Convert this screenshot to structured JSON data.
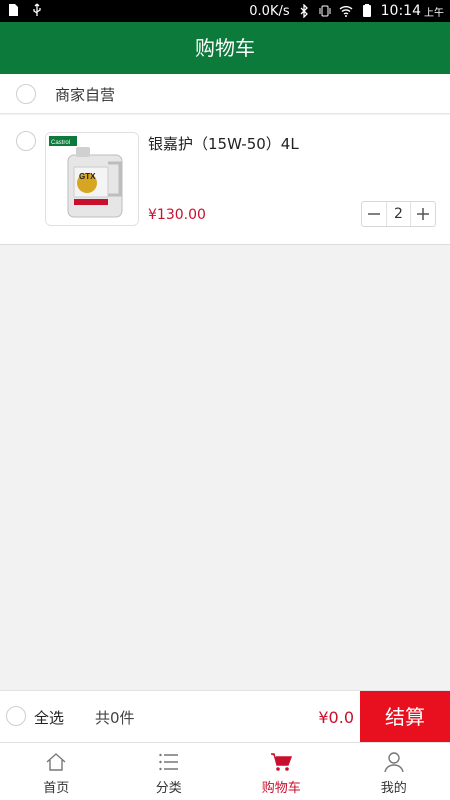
{
  "status_bar": {
    "speed": "0.0K/s",
    "time": "10:14",
    "ampm": "上午"
  },
  "header": {
    "title": "购物车"
  },
  "store": {
    "name": "商家自营"
  },
  "product": {
    "name": "银嘉护（15W-50）4L",
    "price": "¥130.00",
    "quantity": "2",
    "image_brand": "Castrol",
    "image_model": "GTX"
  },
  "checkout": {
    "select_all": "全选",
    "count": "共0件",
    "total": "¥0.0",
    "settle": "结算"
  },
  "tabs": [
    {
      "label": "首页",
      "icon": "home-icon"
    },
    {
      "label": "分类",
      "icon": "list-icon"
    },
    {
      "label": "购物车",
      "icon": "cart-icon"
    },
    {
      "label": "我的",
      "icon": "user-icon"
    }
  ],
  "colors": {
    "header": "#0b7a3a",
    "price": "#c8102e",
    "settle": "#e8101e"
  }
}
